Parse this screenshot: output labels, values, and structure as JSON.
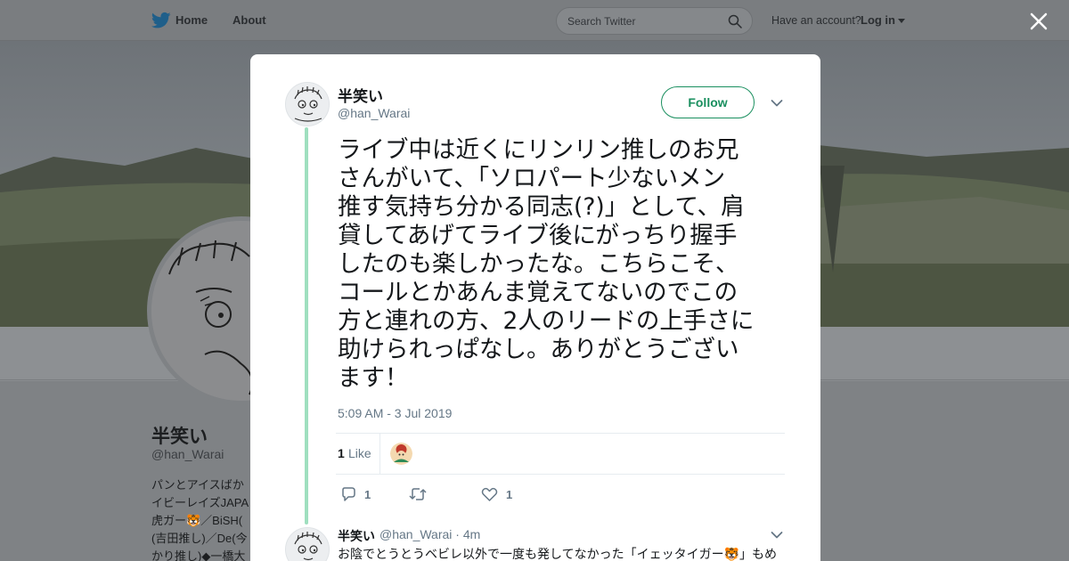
{
  "topbar": {
    "home_label": "Home",
    "about_label": "About",
    "search_placeholder": "Search Twitter",
    "account_prompt": "Have an account?",
    "login_label": "Log in"
  },
  "profile": {
    "name": "半笑い",
    "handle": "@han_Warai",
    "bio": "パンとアイスばか\nイビーレイズJAPA\n虎ガー🐯／BiSH(\n(吉田推し)／De(今\nかり推し)◆一橋大"
  },
  "tweet": {
    "author_name": "半笑い",
    "author_handle": "@han_Warai",
    "follow_label": "Follow",
    "text": "ライブ中は近くにリンリン推しのお兄\nさんがいて、「ソロパート少ないメン\n推す気持ち分かる同志(?)」として、肩\n貸してあげてライブ後にがっちり握手\nしたのも楽しかったな。こちらこそ、\nコールとかあんま覚えてないのでこの\n方と連れの方、2人のリードの上手さに\n助けられっぱなし。ありがとうござい\nます！",
    "timestamp": "5:09 AM - 3 Jul 2019",
    "likes_count": "1",
    "likes_label": "Like",
    "reply_count": "1",
    "retweet_count": "",
    "like_action_count": "1"
  },
  "reply": {
    "author_name": "半笑い",
    "author_handle": "@han_Warai · 4m",
    "text": "お陰でとうとうベビレ以外で一度も発してなかった「イェッタイガー🐯」もめ"
  },
  "colors": {
    "accent": "#1a8f5f",
    "thread_line": "#9fdfbf",
    "secondary_text": "#657786"
  },
  "icons": [
    "twitter-bird-icon",
    "search-icon",
    "close-icon",
    "chevron-down-icon",
    "reply-icon",
    "retweet-icon",
    "heart-icon"
  ]
}
